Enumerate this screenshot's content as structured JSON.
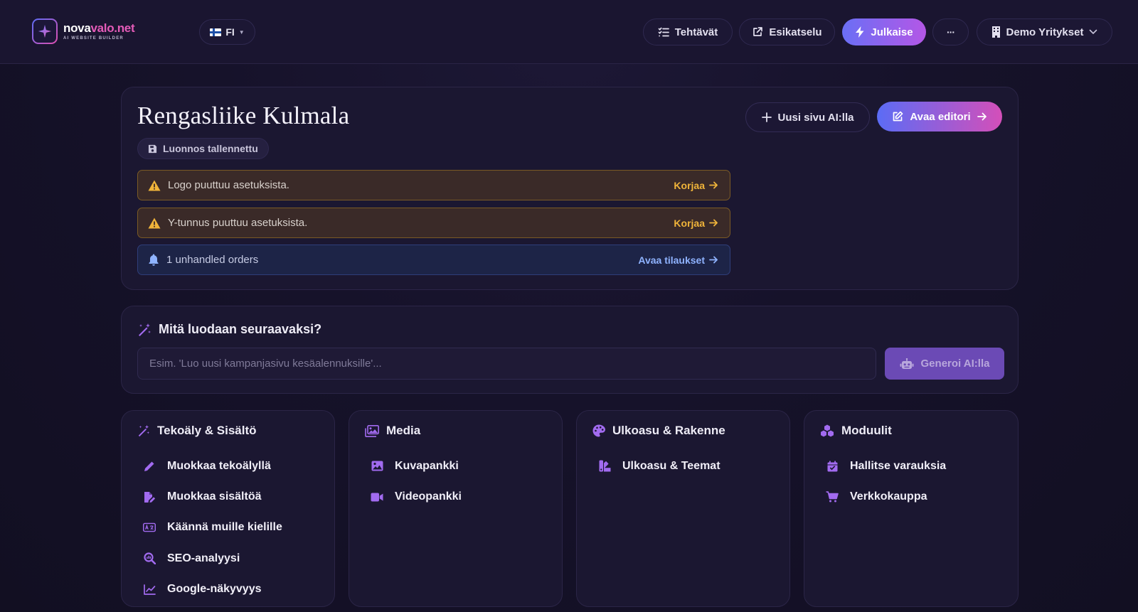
{
  "brand": {
    "name_white": "nova",
    "name_pink": "valo.net",
    "tagline": "AI WEBSITE BUILDER"
  },
  "nav": {
    "language": "FI",
    "tasks": "Tehtävät",
    "preview": "Esikatselu",
    "publish": "Julkaise",
    "more": "···",
    "company": "Demo Yritykset"
  },
  "site": {
    "title": "Rengasliike Kulmala",
    "draft_badge": "Luonnos tallennettu",
    "new_page_button": "Uusi sivu AI:lla",
    "open_editor_button": "Avaa editori",
    "alerts": [
      {
        "type": "warning",
        "message": "Logo puuttuu asetuksista.",
        "action": "Korjaa"
      },
      {
        "type": "warning",
        "message": "Y-tunnus puuttuu asetuksista.",
        "action": "Korjaa"
      },
      {
        "type": "info",
        "message": "1 unhandled orders",
        "action": "Avaa tilaukset"
      }
    ]
  },
  "generate": {
    "heading": "Mitä luodaan seuraavaksi?",
    "placeholder": "Esim. 'Luo uusi kampanjasivu kesäalennuksille'...",
    "button": "Generoi AI:lla"
  },
  "tools": [
    {
      "title": "Tekoäly & Sisältö",
      "items": [
        "Muokkaa tekoälyllä",
        "Muokkaa sisältöä",
        "Käännä muille kielille",
        "SEO-analyysi",
        "Google-näkyvyys"
      ]
    },
    {
      "title": "Media",
      "items": [
        "Kuvapankki",
        "Videopankki"
      ]
    },
    {
      "title": "Ulkoasu & Rakenne",
      "items": [
        "Ulkoasu & Teemat"
      ]
    },
    {
      "title": "Moduulit",
      "items": [
        "Hallitse varauksia",
        "Verkkokauppa"
      ]
    }
  ],
  "colors": {
    "accent": "#a26bf0",
    "warning": "#f0b43a",
    "info": "#8fb3ff",
    "background": "#16122a"
  }
}
